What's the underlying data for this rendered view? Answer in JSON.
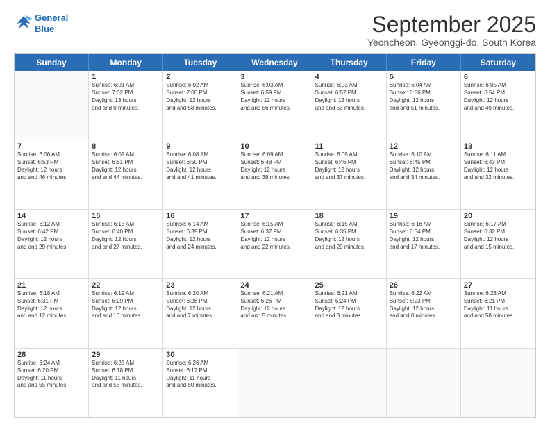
{
  "header": {
    "logo_line1": "General",
    "logo_line2": "Blue",
    "title": "September 2025",
    "location": "Yeoncheon, Gyeonggi-do, South Korea"
  },
  "days_of_week": [
    "Sunday",
    "Monday",
    "Tuesday",
    "Wednesday",
    "Thursday",
    "Friday",
    "Saturday"
  ],
  "weeks": [
    [
      {
        "day": "",
        "sunrise": "",
        "sunset": "",
        "daylight": ""
      },
      {
        "day": "1",
        "sunrise": "Sunrise: 6:01 AM",
        "sunset": "Sunset: 7:02 PM",
        "daylight": "Daylight: 13 hours and 0 minutes."
      },
      {
        "day": "2",
        "sunrise": "Sunrise: 6:02 AM",
        "sunset": "Sunset: 7:00 PM",
        "daylight": "Daylight: 12 hours and 58 minutes."
      },
      {
        "day": "3",
        "sunrise": "Sunrise: 6:03 AM",
        "sunset": "Sunset: 6:59 PM",
        "daylight": "Daylight: 12 hours and 56 minutes."
      },
      {
        "day": "4",
        "sunrise": "Sunrise: 6:03 AM",
        "sunset": "Sunset: 6:57 PM",
        "daylight": "Daylight: 12 hours and 53 minutes."
      },
      {
        "day": "5",
        "sunrise": "Sunrise: 6:04 AM",
        "sunset": "Sunset: 6:56 PM",
        "daylight": "Daylight: 12 hours and 51 minutes."
      },
      {
        "day": "6",
        "sunrise": "Sunrise: 6:05 AM",
        "sunset": "Sunset: 6:54 PM",
        "daylight": "Daylight: 12 hours and 49 minutes."
      }
    ],
    [
      {
        "day": "7",
        "sunrise": "Sunrise: 6:06 AM",
        "sunset": "Sunset: 6:53 PM",
        "daylight": "Daylight: 12 hours and 46 minutes."
      },
      {
        "day": "8",
        "sunrise": "Sunrise: 6:07 AM",
        "sunset": "Sunset: 6:51 PM",
        "daylight": "Daylight: 12 hours and 44 minutes."
      },
      {
        "day": "9",
        "sunrise": "Sunrise: 6:08 AM",
        "sunset": "Sunset: 6:50 PM",
        "daylight": "Daylight: 12 hours and 41 minutes."
      },
      {
        "day": "10",
        "sunrise": "Sunrise: 6:09 AM",
        "sunset": "Sunset: 6:48 PM",
        "daylight": "Daylight: 12 hours and 39 minutes."
      },
      {
        "day": "11",
        "sunrise": "Sunrise: 6:09 AM",
        "sunset": "Sunset: 6:46 PM",
        "daylight": "Daylight: 12 hours and 37 minutes."
      },
      {
        "day": "12",
        "sunrise": "Sunrise: 6:10 AM",
        "sunset": "Sunset: 6:45 PM",
        "daylight": "Daylight: 12 hours and 34 minutes."
      },
      {
        "day": "13",
        "sunrise": "Sunrise: 6:11 AM",
        "sunset": "Sunset: 6:43 PM",
        "daylight": "Daylight: 12 hours and 32 minutes."
      }
    ],
    [
      {
        "day": "14",
        "sunrise": "Sunrise: 6:12 AM",
        "sunset": "Sunset: 6:42 PM",
        "daylight": "Daylight: 12 hours and 29 minutes."
      },
      {
        "day": "15",
        "sunrise": "Sunrise: 6:13 AM",
        "sunset": "Sunset: 6:40 PM",
        "daylight": "Daylight: 12 hours and 27 minutes."
      },
      {
        "day": "16",
        "sunrise": "Sunrise: 6:14 AM",
        "sunset": "Sunset: 6:39 PM",
        "daylight": "Daylight: 12 hours and 24 minutes."
      },
      {
        "day": "17",
        "sunrise": "Sunrise: 6:15 AM",
        "sunset": "Sunset: 6:37 PM",
        "daylight": "Daylight: 12 hours and 22 minutes."
      },
      {
        "day": "18",
        "sunrise": "Sunrise: 6:15 AM",
        "sunset": "Sunset: 6:35 PM",
        "daylight": "Daylight: 12 hours and 20 minutes."
      },
      {
        "day": "19",
        "sunrise": "Sunrise: 6:16 AM",
        "sunset": "Sunset: 6:34 PM",
        "daylight": "Daylight: 12 hours and 17 minutes."
      },
      {
        "day": "20",
        "sunrise": "Sunrise: 6:17 AM",
        "sunset": "Sunset: 6:32 PM",
        "daylight": "Daylight: 12 hours and 15 minutes."
      }
    ],
    [
      {
        "day": "21",
        "sunrise": "Sunrise: 6:18 AM",
        "sunset": "Sunset: 6:31 PM",
        "daylight": "Daylight: 12 hours and 12 minutes."
      },
      {
        "day": "22",
        "sunrise": "Sunrise: 6:19 AM",
        "sunset": "Sunset: 6:29 PM",
        "daylight": "Daylight: 12 hours and 10 minutes."
      },
      {
        "day": "23",
        "sunrise": "Sunrise: 6:20 AM",
        "sunset": "Sunset: 6:28 PM",
        "daylight": "Daylight: 12 hours and 7 minutes."
      },
      {
        "day": "24",
        "sunrise": "Sunrise: 6:21 AM",
        "sunset": "Sunset: 6:26 PM",
        "daylight": "Daylight: 12 hours and 5 minutes."
      },
      {
        "day": "25",
        "sunrise": "Sunrise: 6:21 AM",
        "sunset": "Sunset: 6:24 PM",
        "daylight": "Daylight: 12 hours and 3 minutes."
      },
      {
        "day": "26",
        "sunrise": "Sunrise: 6:22 AM",
        "sunset": "Sunset: 6:23 PM",
        "daylight": "Daylight: 12 hours and 0 minutes."
      },
      {
        "day": "27",
        "sunrise": "Sunrise: 6:23 AM",
        "sunset": "Sunset: 6:21 PM",
        "daylight": "Daylight: 11 hours and 58 minutes."
      }
    ],
    [
      {
        "day": "28",
        "sunrise": "Sunrise: 6:24 AM",
        "sunset": "Sunset: 6:20 PM",
        "daylight": "Daylight: 11 hours and 55 minutes."
      },
      {
        "day": "29",
        "sunrise": "Sunrise: 6:25 AM",
        "sunset": "Sunset: 6:18 PM",
        "daylight": "Daylight: 11 hours and 53 minutes."
      },
      {
        "day": "30",
        "sunrise": "Sunrise: 6:26 AM",
        "sunset": "Sunset: 6:17 PM",
        "daylight": "Daylight: 11 hours and 50 minutes."
      },
      {
        "day": "",
        "sunrise": "",
        "sunset": "",
        "daylight": ""
      },
      {
        "day": "",
        "sunrise": "",
        "sunset": "",
        "daylight": ""
      },
      {
        "day": "",
        "sunrise": "",
        "sunset": "",
        "daylight": ""
      },
      {
        "day": "",
        "sunrise": "",
        "sunset": "",
        "daylight": ""
      }
    ]
  ]
}
